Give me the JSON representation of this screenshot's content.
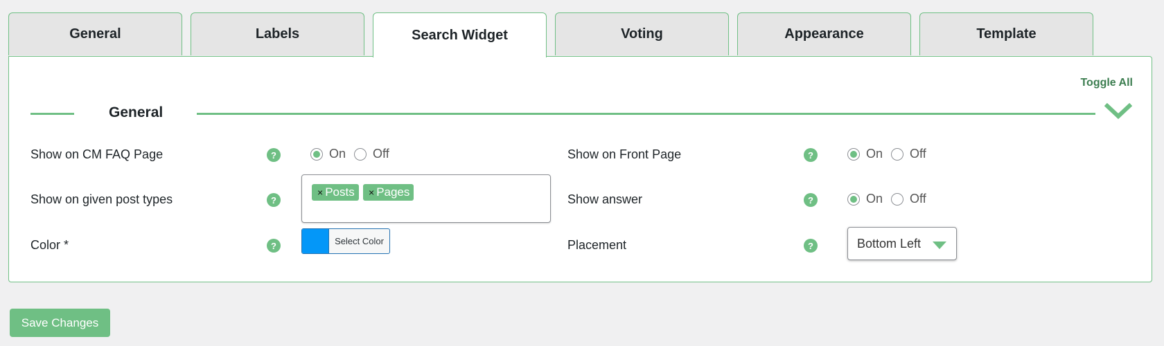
{
  "tabs": [
    {
      "label": "General",
      "active": false
    },
    {
      "label": "Labels",
      "active": false
    },
    {
      "label": "Search Widget",
      "active": true
    },
    {
      "label": "Voting",
      "active": false
    },
    {
      "label": "Appearance",
      "active": false
    },
    {
      "label": "Template",
      "active": false
    }
  ],
  "panel": {
    "toggle_all": "Toggle All",
    "section_title": "General"
  },
  "settings": {
    "show_on_cm_faq_page": {
      "label": "Show on CM FAQ Page",
      "help": "?",
      "value": "On"
    },
    "show_on_post_types": {
      "label": "Show on given post types",
      "help": "?",
      "tags": [
        "Posts",
        "Pages"
      ],
      "remove_glyph": "×"
    },
    "color": {
      "label": "Color *",
      "help": "?",
      "button_text": "Select Color",
      "value": "#0497f8"
    },
    "show_on_front_page": {
      "label": "Show on Front Page",
      "help": "?",
      "value": "On"
    },
    "show_answer": {
      "label": "Show answer",
      "help": "?",
      "value": "On"
    },
    "placement": {
      "label": "Placement",
      "help": "?",
      "selected": "Bottom Left"
    }
  },
  "radio_labels": {
    "on": "On",
    "off": "Off"
  },
  "save_button": "Save Changes",
  "colors": {
    "accent": "#6fbf84",
    "accent_dark": "#3b7d4f",
    "swatch": "#0497f8"
  }
}
